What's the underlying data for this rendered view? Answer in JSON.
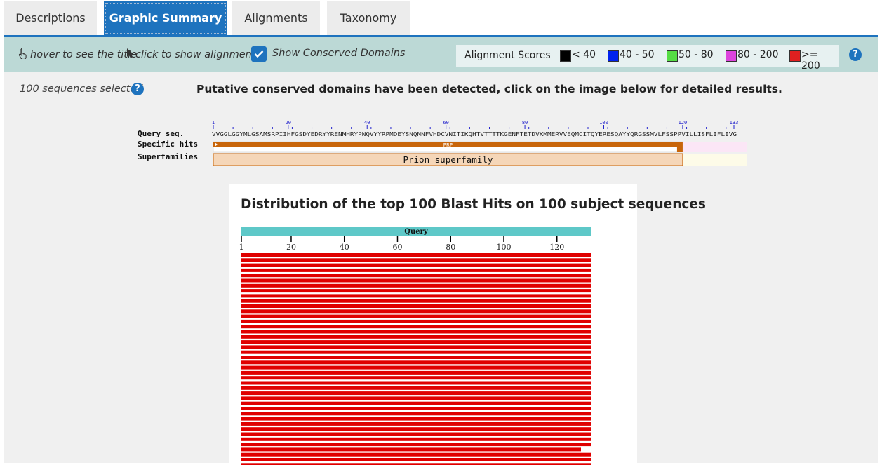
{
  "tabs": [
    {
      "label": "Descriptions"
    },
    {
      "label": "Graphic Summary"
    },
    {
      "label": "Alignments"
    },
    {
      "label": "Taxonomy"
    }
  ],
  "toolbar": {
    "hover_text": "hover to see the title",
    "click_text": "click to show alignments",
    "conserved_label": "Show Conserved Domains",
    "conserved_checked": true,
    "scores_title": "Alignment Scores",
    "legend": [
      {
        "label": "< 40",
        "color": "#000000"
      },
      {
        "label": "40 - 50",
        "color": "#0022ee"
      },
      {
        "label": "50 - 80",
        "color": "#55dd44"
      },
      {
        "label": "80 - 200",
        "color": "#dd44dd"
      },
      {
        "label": ">= 200",
        "color": "#e02020"
      }
    ]
  },
  "main": {
    "selected_text": "100 sequences selected",
    "cdd_notice": "Putative conserved domains have been detected, click on the image below for detailed results."
  },
  "cdd": {
    "ruler_ticks": [
      "1",
      "20",
      "40",
      "60",
      "80",
      "100",
      "120",
      "133"
    ],
    "query_label": "Query seq.",
    "query_sequence": "VVGGLGGYMLGSAMSRPIIHFGSDYEDRYYRENMHRYPNQVYYRPMDEYSNQNNFVHDCVNITIKQHTVTTTTKGENFTETDVKMMERVVEQMCITQYERESQAYYQRGSSMVLFSSPPVILLISFLIFLIVG",
    "specific_label": "Specific hits",
    "specific_hit": "PRP",
    "super_label": "Superfamilies",
    "superfamily": "Prion superfamily",
    "hit_color": "#c8650a",
    "super_color": "#f5d6b8"
  },
  "distribution": {
    "title": "Distribution of the top 100 Blast Hits on 100 subject sequences",
    "query_label": "Query",
    "axis_ticks": [
      "1",
      "20",
      "40",
      "60",
      "80",
      "100",
      "120"
    ],
    "bar_color": "#e00000",
    "query_bar_color": "#5ec8c8"
  }
}
